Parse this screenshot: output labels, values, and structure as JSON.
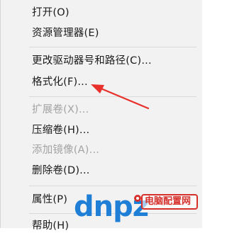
{
  "context_menu": {
    "items": [
      {
        "label": "打开(O)",
        "disabled": false
      },
      {
        "label": "资源管理器(E)",
        "disabled": false
      },
      {
        "label": "更改驱动器号和路径(C)...",
        "disabled": false
      },
      {
        "label": "格式化(F)...",
        "disabled": false
      },
      {
        "label": "扩展卷(X)...",
        "disabled": true
      },
      {
        "label": "压缩卷(H)...",
        "disabled": false
      },
      {
        "label": "添加镜像(A)...",
        "disabled": true
      },
      {
        "label": "删除卷(D)...",
        "disabled": false
      },
      {
        "label": "属性(P)",
        "disabled": false
      },
      {
        "label": "帮助(H)",
        "disabled": false
      }
    ]
  },
  "annotation": {
    "icon": "red-arrow-icon",
    "color": "#e8312c"
  },
  "watermark": {
    "letters": "dnpz",
    "site_name": "电脑配置网",
    "colors": {
      "letters": "#1f7fd6",
      "site": "#d6302b"
    }
  }
}
